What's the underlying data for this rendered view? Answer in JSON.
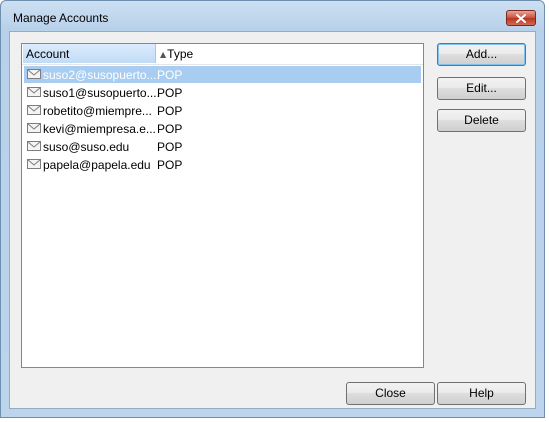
{
  "window": {
    "title": "Manage Accounts"
  },
  "list": {
    "columns": {
      "account": "Account",
      "type": "Type"
    },
    "rows": [
      {
        "account": "suso2@susopuerto....",
        "type": "POP",
        "selected": true
      },
      {
        "account": "suso1@susopuerto....",
        "type": "POP",
        "selected": false
      },
      {
        "account": "robetito@miempre...",
        "type": "POP",
        "selected": false
      },
      {
        "account": "kevi@miempresa.e...",
        "type": "POP",
        "selected": false
      },
      {
        "account": "suso@suso.edu",
        "type": "POP",
        "selected": false
      },
      {
        "account": "papela@papela.edu",
        "type": "POP",
        "selected": false
      }
    ]
  },
  "buttons": {
    "add": "Add...",
    "edit": "Edit...",
    "delete": "Delete",
    "close": "Close",
    "help": "Help"
  },
  "icons": {
    "title_close": "close-icon",
    "row_icon": "envelope-icon",
    "sort": "sort-ascending-icon"
  },
  "colors": {
    "selection": "#a8cdf1",
    "title_close": "#c9503d",
    "frame": "#bcd4ec"
  }
}
